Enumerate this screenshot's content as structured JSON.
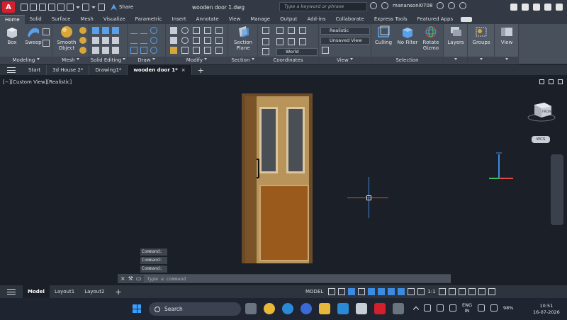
{
  "window": {
    "document_title": "wooden door 1.dwg",
    "search_placeholder": "Type a keyword or phrase",
    "user": "manansoni0708",
    "share_label": "Share",
    "app_letter": "A"
  },
  "ribbon_tabs": [
    "Home",
    "Solid",
    "Surface",
    "Mesh",
    "Visualize",
    "Parametric",
    "Insert",
    "Annotate",
    "View",
    "Manage",
    "Output",
    "Add-ins",
    "Collaborate",
    "Express Tools",
    "Featured Apps"
  ],
  "ribbon": {
    "panels": {
      "modeling": "Modeling",
      "mesh": "Mesh",
      "solid_editing": "Solid Editing",
      "draw": "Draw",
      "modify": "Modify",
      "section": "Section",
      "coordinates": "Coordinates",
      "view": "View",
      "selection": "Selection"
    },
    "buttons": {
      "box": "Box",
      "sweep": "Sweep",
      "smooth_object": "Smooth Object",
      "section_plane": "Section Plane",
      "culling": "Culling",
      "no_filter": "No Filter",
      "rotate_gizmo": "Rotate Gizmo",
      "layers": "Layers",
      "groups": "Groups",
      "view": "View"
    },
    "combos": {
      "visual_style": "Realistic",
      "saved_view": "Unsaved View",
      "ucs": "World"
    }
  },
  "file_tabs": [
    {
      "label": "Start",
      "active": false,
      "closable": false
    },
    {
      "label": "3d House 2*",
      "active": false,
      "closable": false
    },
    {
      "label": "Drawing1*",
      "active": false,
      "closable": false
    },
    {
      "label": "wooden door 1*",
      "active": true,
      "closable": true
    }
  ],
  "viewport": {
    "label": "[−][Custom View][Realistic]",
    "viewcube_face": "FRONT",
    "wcs": "WCS"
  },
  "command": {
    "history": [
      "Command:",
      "Command:",
      "Command:"
    ],
    "placeholder": "Type a command"
  },
  "layout_tabs": [
    {
      "label": "Model",
      "active": true
    },
    {
      "label": "Layout1",
      "active": false
    },
    {
      "label": "Layout2",
      "active": false
    }
  ],
  "status": {
    "model_label": "MODEL",
    "scale": "1:1"
  },
  "taskbar": {
    "search_label": "Search",
    "lang_line1": "ENG",
    "lang_line2": "IN",
    "battery": "98%",
    "time": "10:51",
    "date": "16-07-2026"
  },
  "colors": {
    "accent": "#3b8be0",
    "brand": "#d4202c"
  }
}
